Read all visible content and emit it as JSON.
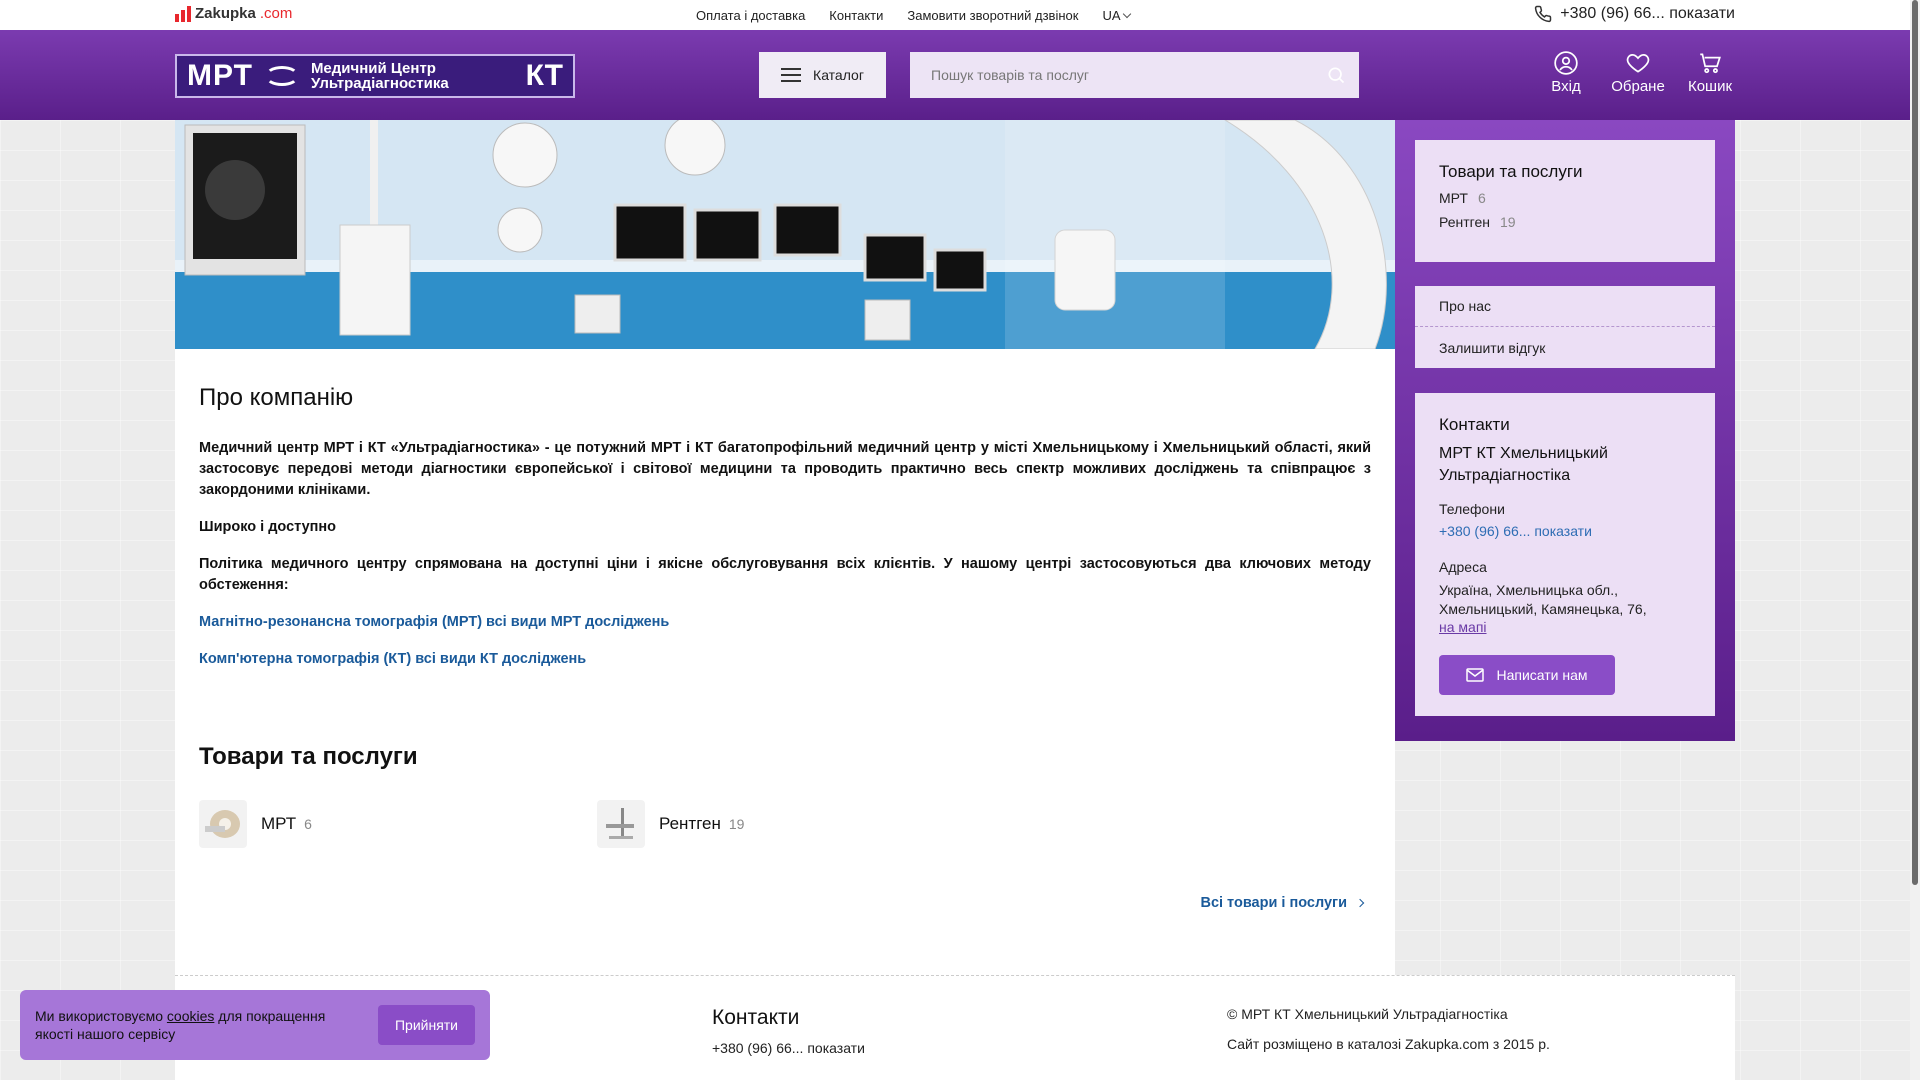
{
  "topbar": {
    "logo_text": "Zakupka",
    "logo_domain": ".com",
    "nav": [
      "Оплата і доставка",
      "Контакти",
      "Замовити зворотний дзвінок"
    ],
    "lang": "UA",
    "phone": "+380 (96) 66... показати"
  },
  "header": {
    "brand_left": "МРТ",
    "brand_name_line1": "Медичний Центр",
    "brand_name_line2": "Ультрадіагностика",
    "brand_right": "КТ",
    "catalog_label": "Каталог",
    "search_placeholder": "Пошук товарів та послуг",
    "icons": [
      {
        "label": "Вхід",
        "icon": "user-icon"
      },
      {
        "label": "Обране",
        "icon": "heart-icon"
      },
      {
        "label": "Кошик",
        "icon": "cart-icon"
      }
    ]
  },
  "main": {
    "about_title": "Про компанію",
    "about_p1": "Медичний  центр МРТ і КТ «Ультрадіагностика» - це потужний МРТ і КТ багатопрофільний медичний центр у місті Хмельницькому і Хмельницький області, який застосовує передові методи діагностики європейської і світової медицини та проводить практично весь спектр можливих досліджень та співпрацює з закордоними клініками.",
    "about_p2": "Широко і доступно",
    "about_p3": "Політика медичного центру спрямована на доступні ціни і якісне обслуговування всіх клієнтів. У нашому центрі застосовуються два ключових методу обстеження:",
    "link1": "Магнітно-резонансна томографія (МРТ) всі види МРТ досліджень",
    "link2": "Комп'ютерна томографія (КТ) всі види КТ досліджень",
    "goods_title": "Товари та послуги",
    "categories": [
      {
        "name": "МРТ",
        "count": "6"
      },
      {
        "name": "Рентген",
        "count": "19"
      }
    ],
    "all_goods": "Всі товари і послуги"
  },
  "sidebar": {
    "goods_title": "Товари та послуги",
    "goods": [
      {
        "name": "МРТ",
        "count": "6"
      },
      {
        "name": "Рентген",
        "count": "19"
      }
    ],
    "links": [
      "Про нас",
      "Залишити відгук"
    ],
    "contacts_title": "Контакти",
    "company": "МРТ КТ Хмельницький Ультрадіагностіка",
    "phones_label": "Телефони",
    "phone": "+380 (96) 66... показати",
    "address_label": "Адреса",
    "address": "Україна, Хмельницька обл., Хмельницький, Камянецька, 76,",
    "map_link": "на мапі",
    "write_btn": "Написати нам"
  },
  "footer": {
    "contacts_title": "Контакти",
    "phone": "+380 (96) 66... показати",
    "copyright": "© МРТ КТ Хмельницький Ультрадіагностіка",
    "catalog_note": "Сайт розміщено в каталозі Zakupka.com з 2015 р."
  },
  "cookie": {
    "text_before": "Ми використовуємо ",
    "link": "cookies",
    "text_after": " для покращення якості нашого сервісу",
    "accept": "Прийняти"
  },
  "colors": {
    "accent": "#7b3bb0",
    "button": "#8a4dc7",
    "link": "#1a5a9a",
    "brand_red": "#e8272d"
  }
}
